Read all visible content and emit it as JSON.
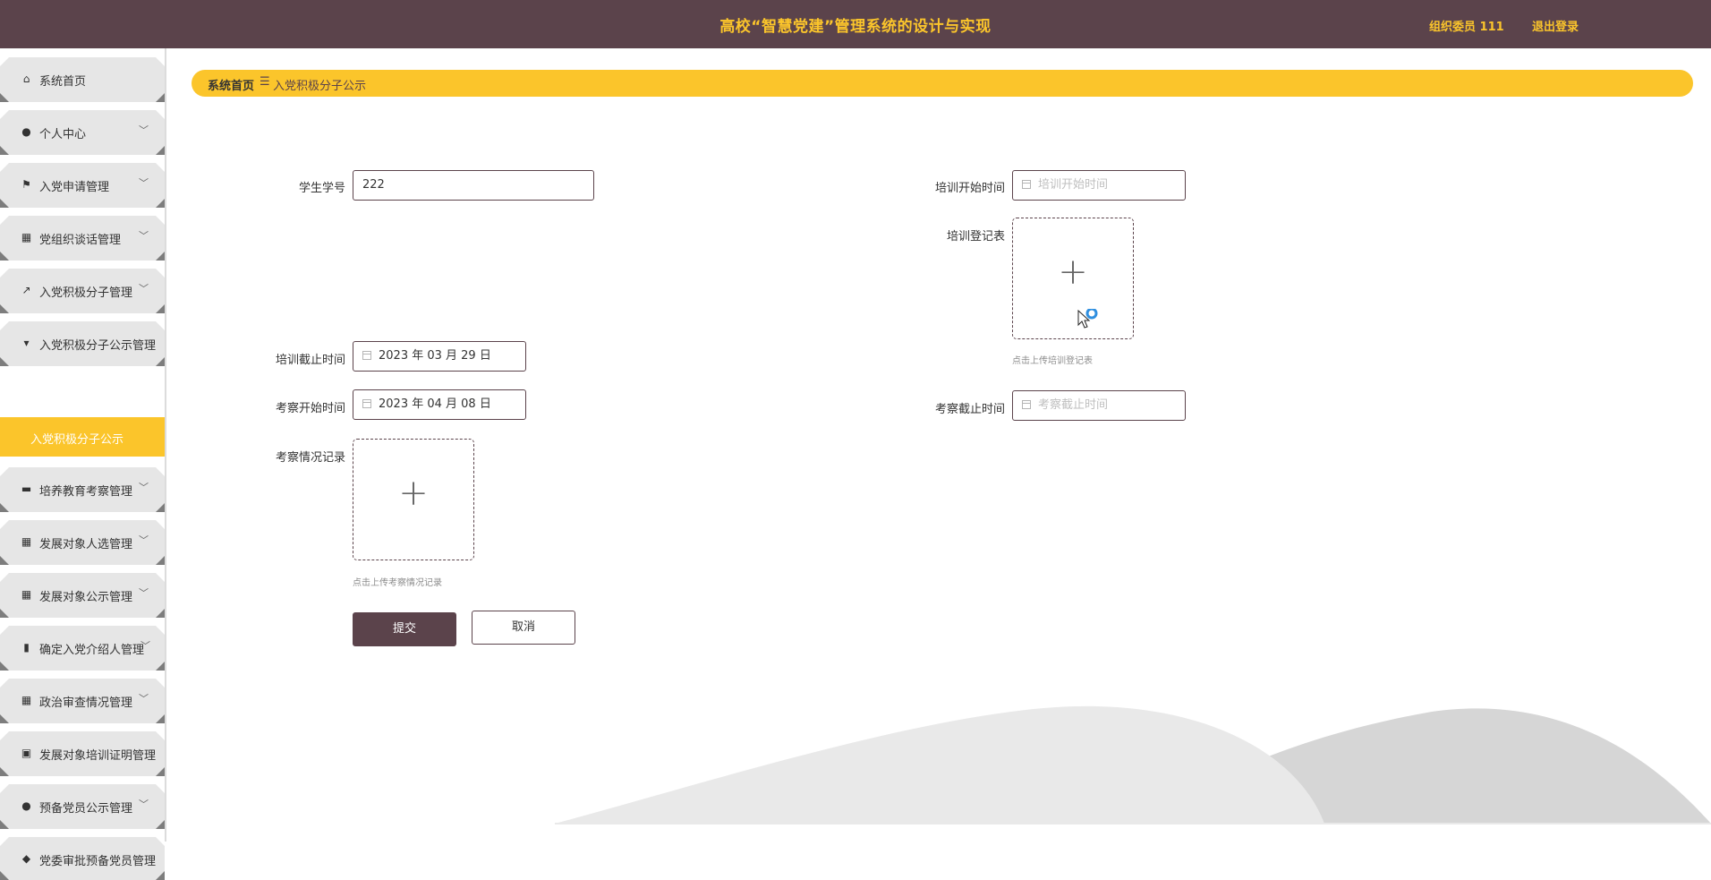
{
  "header": {
    "title": "高校“智慧党建”管理系统的设计与实现",
    "user": "组织委员 111",
    "logout": "退出登录"
  },
  "sidebar": {
    "items": [
      {
        "label": "系统首页",
        "icon": "home-icon",
        "chevron": false
      },
      {
        "label": "个人中心",
        "icon": "user-icon",
        "chevron": true
      },
      {
        "label": "入党申请管理",
        "icon": "flag-icon",
        "chevron": true
      },
      {
        "label": "党组织谈话管理",
        "icon": "grid-icon",
        "chevron": true
      },
      {
        "label": "入党积极分子管理",
        "icon": "chart-line-icon",
        "chevron": true
      },
      {
        "label": "入党积极分子公示管理",
        "icon": "brush-icon",
        "chevron": false
      },
      {
        "label": "培养教育考察管理",
        "icon": "briefcase-icon",
        "chevron": true
      },
      {
        "label": "发展对象人选管理",
        "icon": "grid-icon",
        "chevron": true
      },
      {
        "label": "发展对象公示管理",
        "icon": "grid-icon",
        "chevron": true
      },
      {
        "label": "确定入党介绍人管理",
        "icon": "bar-chart-icon",
        "chevron": true
      },
      {
        "label": "政治审查情况管理",
        "icon": "grid-icon",
        "chevron": true
      },
      {
        "label": "发展对象培训证明管理",
        "icon": "trash-icon",
        "chevron": false
      },
      {
        "label": "预备党员公示管理",
        "icon": "user-icon",
        "chevron": true
      },
      {
        "label": "党委审批预备党员管理",
        "icon": "map-pin-icon",
        "chevron": false
      }
    ],
    "active_submenu": "入党积极分子公示"
  },
  "breadcrumb": {
    "home": "系统首页",
    "separator": "☰",
    "current": "入党积极分子公示"
  },
  "form": {
    "student_id": {
      "label": "学生学号",
      "value": "222"
    },
    "training_start": {
      "label": "培训开始时间",
      "placeholder": "培训开始时间"
    },
    "training_form": {
      "label": "培训登记表",
      "hint": "点击上传培训登记表"
    },
    "training_end": {
      "label": "培训截止时间",
      "value": "2023 年 03 月 29 日"
    },
    "inspect_start": {
      "label": "考察开始时间",
      "value": "2023 年 04 月 08 日"
    },
    "inspect_end": {
      "label": "考察截止时间",
      "placeholder": "考察截止时间"
    },
    "inspect_record": {
      "label": "考察情况记录",
      "hint": "点击上传考察情况记录"
    },
    "submit": "提交",
    "cancel": "取消"
  },
  "colors": {
    "header_bg": "#5b434b",
    "accent": "#fbc52b",
    "menu_bg": "#e6e6e6"
  }
}
